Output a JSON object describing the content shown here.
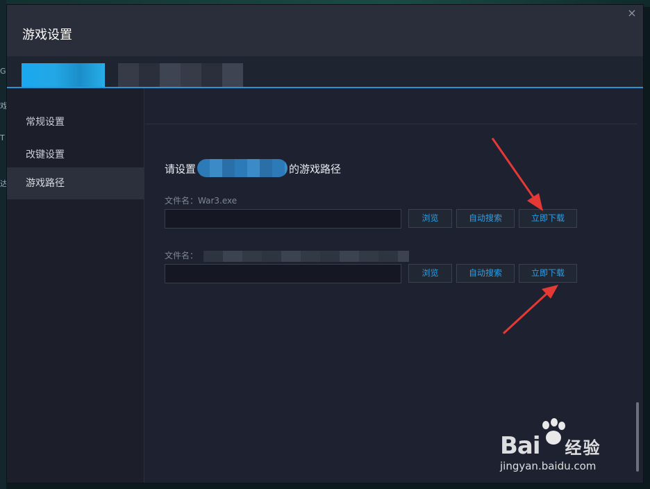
{
  "window": {
    "title": "游戏设置",
    "close_glyph": "×"
  },
  "sidebar": {
    "items": [
      {
        "label": "常规设置",
        "active": false
      },
      {
        "label": "改键设置",
        "active": false
      },
      {
        "label": "游戏路径",
        "active": true
      }
    ]
  },
  "main": {
    "heading_prefix": "请设置",
    "heading_suffix": "的游戏路径",
    "rows": [
      {
        "filename_label": "文件名：War3.exe",
        "path_value": "",
        "browse_label": "浏览",
        "auto_search_label": "自动搜索",
        "download_label": "立即下载"
      },
      {
        "filename_label": "文件名：",
        "path_value": "",
        "browse_label": "浏览",
        "auto_search_label": "自动搜索",
        "download_label": "立即下载"
      }
    ]
  },
  "background_letters": [
    "G",
    "戏",
    "T",
    "达"
  ],
  "watermark": {
    "brand": "Bai",
    "brand_cn": "经验",
    "url": "jingyan.baidu.com"
  },
  "colors": {
    "accent": "#2a95d6",
    "button_text": "#2aa0e6",
    "annotation_arrow": "#e53935"
  }
}
